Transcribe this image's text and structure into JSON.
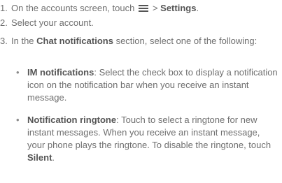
{
  "steps": [
    {
      "number": "1.",
      "before": "On the accounts screen, touch",
      "icon": "menu-icon",
      "after_prefix": " > ",
      "after_bold": "Settings",
      "after_end": "."
    },
    {
      "number": "2.",
      "text": "Select your account."
    },
    {
      "number": "3.",
      "before": "In the",
      "bold": "Chat notifications",
      "after": "section, select one of the following:"
    }
  ],
  "bullets": [
    {
      "marker": "•",
      "bold": "IM notifications",
      "text": ": Select the check box to display a notification icon on the notification bar when you receive an instant message."
    },
    {
      "marker": "•",
      "bold": "Notification ringtone",
      "text": ": Touch to select a ringtone for new instant messages. When you receive an instant message, your phone plays the ringtone. To disable the ringtone, touch",
      "bold_end": "Silent",
      "end": "."
    }
  ]
}
